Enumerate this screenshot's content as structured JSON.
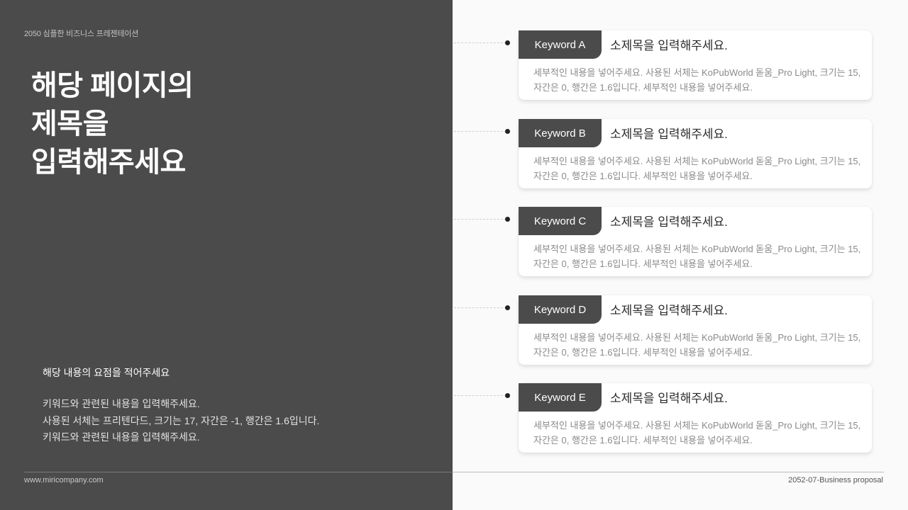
{
  "header": {
    "top_label": "2050 심플한 비즈니스 프레젠테이션"
  },
  "title": {
    "lines": [
      "해당 페이지의",
      "제목을",
      "입력해주세요"
    ]
  },
  "summary": {
    "heading": "해당 내용의 요점을 적어주세요",
    "lines": [
      "키워드와 관련된 내용을 입력해주세요.",
      "사용된 서체는 프리텐다드, 크기는 17, 자간은 -1, 행간은 1.6입니다.",
      "키워드와 관련된 내용을 입력해주세요."
    ]
  },
  "items": [
    {
      "keyword": "Keyword A",
      "subtitle": "소제목을 입력해주세요.",
      "desc_line1": "세부적인 내용을 넣어주세요. 사용된 서체는 KoPubWorld 돋움_Pro Light, 크기는 15,",
      "desc_line2": "자간은 0, 행간은 1.6입니다. 세부적인 내용을 넣어주세요."
    },
    {
      "keyword": "Keyword B",
      "subtitle": "소제목을 입력해주세요.",
      "desc_line1": "세부적인 내용을 넣어주세요. 사용된 서체는 KoPubWorld 돋움_Pro Light, 크기는 15,",
      "desc_line2": "자간은 0, 행간은 1.6입니다. 세부적인 내용을 넣어주세요."
    },
    {
      "keyword": "Keyword C",
      "subtitle": "소제목을 입력해주세요.",
      "desc_line1": "세부적인 내용을 넣어주세요. 사용된 서체는 KoPubWorld 돋움_Pro Light, 크기는 15,",
      "desc_line2": "자간은 0, 행간은 1.6입니다. 세부적인 내용을 넣어주세요."
    },
    {
      "keyword": "Keyword D",
      "subtitle": "소제목을 입력해주세요.",
      "desc_line1": "세부적인 내용을 넣어주세요. 사용된 서체는 KoPubWorld 돋움_Pro Light, 크기는 15,",
      "desc_line2": "자간은 0, 행간은 1.6입니다. 세부적인 내용을 넣어주세요."
    },
    {
      "keyword": "Keyword E",
      "subtitle": "소제목을 입력해주세요.",
      "desc_line1": "세부적인 내용을 넣어주세요. 사용된 서체는 KoPubWorld 돋움_Pro Light, 크기는 15,",
      "desc_line2": "자간은 0, 행간은 1.6입니다. 세부적인 내용을 넣어주세요."
    }
  ],
  "footer": {
    "left": "www.miricompany.com",
    "right": "2052-07-Business proposal"
  },
  "colors": {
    "dark_panel": "#4b4b4b",
    "light_bg": "#fafafa",
    "card_bg": "#ffffff"
  }
}
